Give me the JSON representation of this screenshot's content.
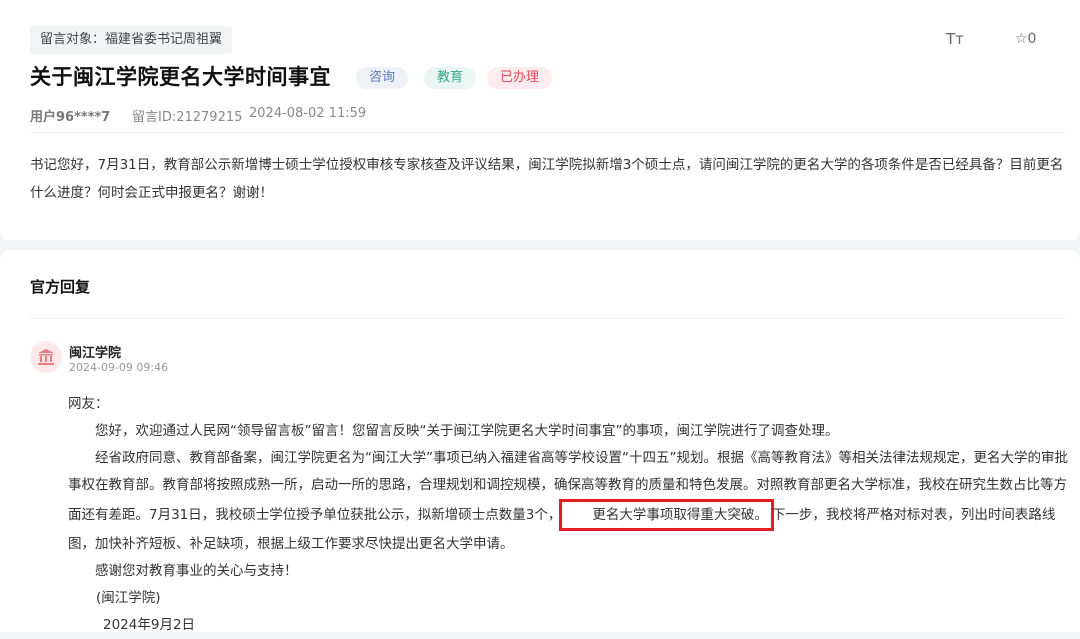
{
  "header": {
    "target_tag": "留言对象：福建省委书记周祖翼",
    "title": "关于闽江学院更名大学时间事宜",
    "badges": [
      "咨询",
      "教育",
      "已办理"
    ],
    "font_icon": "Tт",
    "favorite_icon": "star-icon",
    "favorite_count": "☆0"
  },
  "meta": {
    "user": "用户96****7",
    "message_id": "留言ID:21279215",
    "date": "2024-08-02 11:59"
  },
  "message": "书记您好，7月31日，教育部公示新增博士硕士学位授权审核专家核查及评议结果，闽江学院拟新增3个硕士点，请问闽江学院的更名大学的各项条件是否已经具备？目前更名什么进度？何时会正式申报更名？谢谢！",
  "reply_section": {
    "title": "官方回复",
    "org": "闽江学院",
    "date": "2024-09-09 09:46",
    "salutation": "网友：",
    "para1": "您好，欢迎通过人民网“领导留言板”留言！您留言反映“关于闽江学院更名大学时间事宜”的事项，闽江学院进行了调查处理。",
    "para2_before": "经省政府同意、教育部备案，闽江学院更名为“闽江大学”事项已纳入福建省高等学校设置“十四五”规划。根据《高等教育法》等相关法律法规规定，更名大学的审批事权在教育部。教育部将按照成熟一所，启动一所的思路，合理规划和调控规模，确保高等教育的质量和特色发展。对照教育部更名大学标准，我校在研究生数占比等方面还有差距。7月31日，我校硕士学位授予单位获批公示，拟新增硕士点数量3个，",
    "para2_highlight": "更名大学事项取得重大突破。",
    "para2_after": "下一步，我校将严格对标对表，列出时间表路线图，加快补齐短板、补足缺项，根据上级工作要求尽快提出更名大学申请。",
    "para3": "感谢您对教育事业的关心与支持！",
    "sig_org": "(闽江学院)",
    "sig_date": "2024年9月2日"
  },
  "colors": {
    "highlight_border": "#e51c23",
    "badge_consult": "#5a7bb5",
    "badge_education": "#3aa58c",
    "badge_done": "#e0495b"
  }
}
